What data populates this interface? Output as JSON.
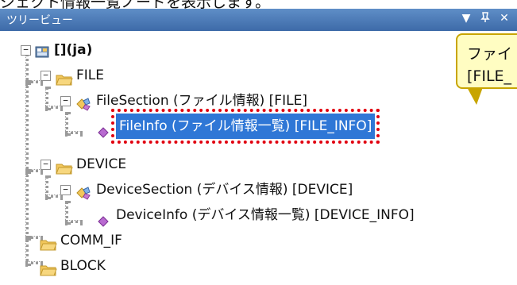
{
  "page_caption": "ジェクト情報一覧ノードを表示します。",
  "panel": {
    "title": "ツリービュー",
    "controls": {
      "dropdown_glyph": "▼",
      "pin_glyph": "📌",
      "close_glyph": "✕"
    }
  },
  "tree": {
    "root": {
      "label": "[](ja)"
    },
    "file_folder": {
      "label": "FILE"
    },
    "file_section": {
      "label": "FileSection (ファイル情報) [FILE]"
    },
    "file_info": {
      "label": "FileInfo (ファイル情報一覧) [FILE_INFO]"
    },
    "device_folder": {
      "label": "DEVICE"
    },
    "device_section": {
      "label": "DeviceSection (デバイス情報) [DEVICE]"
    },
    "device_info": {
      "label": "DeviceInfo (デバイス情報一覧) [DEVICE_INFO]"
    },
    "comm_folder": {
      "label": "COMM_IF"
    },
    "block_folder": {
      "label": "BLOCK"
    }
  },
  "callout": {
    "line1": "ファイ",
    "line2": "[FILE_"
  },
  "colors": {
    "titlebar": "#4a78b8",
    "selection": "#2f77d6",
    "highlight_border": "#e1000f",
    "callout_fill": "#fffdc2",
    "folder": "#f2c75c"
  }
}
